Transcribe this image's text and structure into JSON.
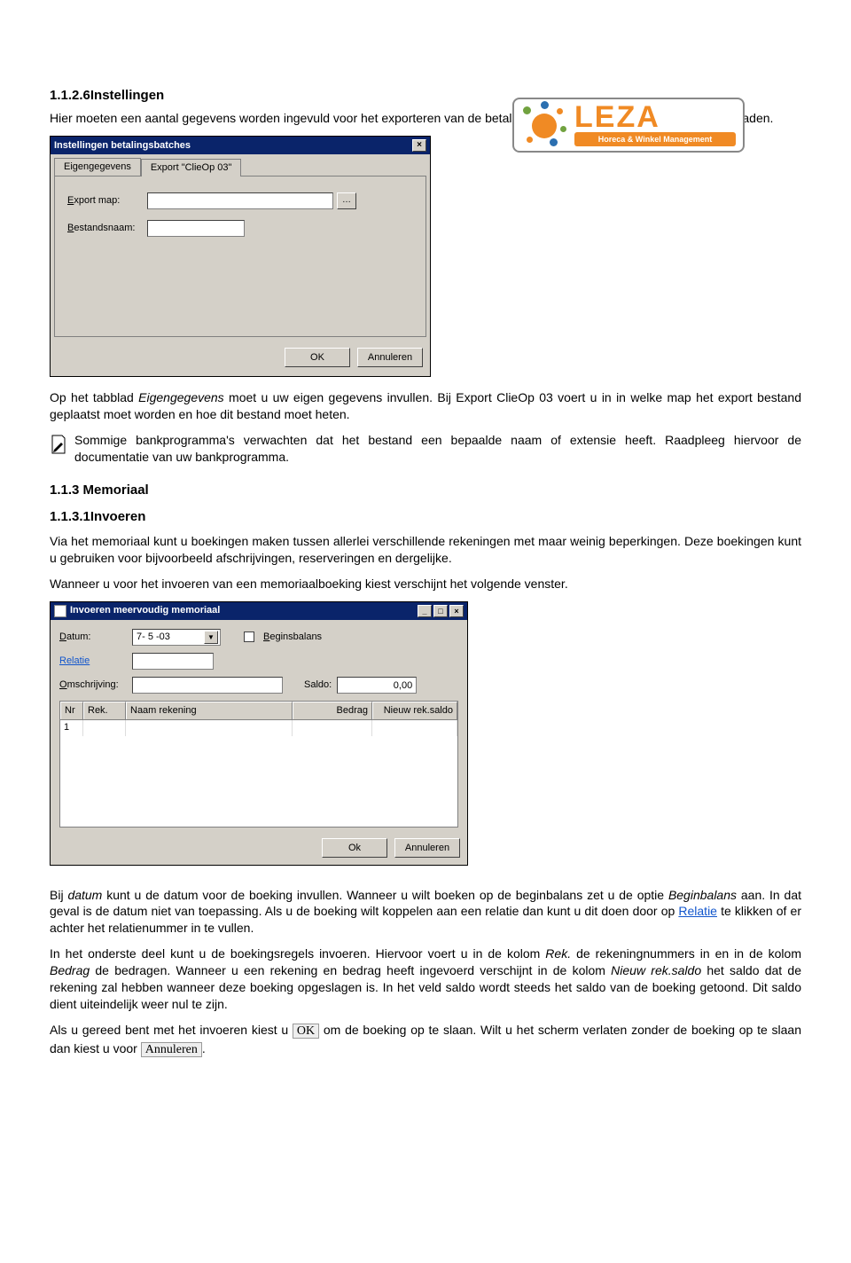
{
  "logo": {
    "brand": "LEZA",
    "tagline": "Horeca & Winkel Management"
  },
  "s1": {
    "num": "1.1.2.6",
    "title": "Instellingen",
    "intro": "Hier moeten een aantal gegevens worden ingevuld voor het exporteren van de betalingsbatches. Het scherm bevat twee tabbladen.",
    "after1a": "Op het tabblad ",
    "after1i": "Eigengegevens",
    "after1b": " moet u uw eigen gegevens invullen. Bij Export ClieOp 03 voert u in in welke map het export bestand geplaatst moet worden en hoe dit bestand moet heten.",
    "note": "Sommige bankprogramma's verwachten dat het bestand een bepaalde naam of extensie heeft. Raadpleeg hiervoor de documentatie van uw bankprogramma."
  },
  "dlg1": {
    "title": "Instellingen betalingsbatches",
    "tab1": "Eigengegevens",
    "tab2": "Export \"ClieOp 03\"",
    "lblExportMap": "Export map:",
    "lblBestandsnaam": "Bestandsnaam:",
    "exportMapValue": "",
    "bestandsnaamValue": "",
    "ok": "OK",
    "cancel": "Annuleren"
  },
  "s2": {
    "h1": "1.1.3 Memoriaal",
    "h2num": "1.1.3.1",
    "h2title": "Invoeren",
    "p1": "Via het memoriaal kunt u boekingen maken tussen allerlei verschillende rekeningen met maar weinig beperkingen. Deze boekingen kunt u gebruiken voor bijvoorbeeld afschrijvingen, reserveringen en dergelijke.",
    "p2": "Wanneer u voor het invoeren van een memoriaalboeking kiest verschijnt het volgende venster."
  },
  "dlg2": {
    "title": "Invoeren meervoudig memoriaal",
    "lblDatum": "Datum:",
    "datumValue": "7- 5 -03",
    "lblBeginsbalans": "Beginsbalans",
    "lblRelatie": "Relatie",
    "relatieValue": "",
    "lblOmschrijving": "Omschrijving:",
    "omschrijvingValue": "",
    "lblSaldo": "Saldo:",
    "saldoValue": "0,00",
    "col": {
      "nr": "Nr",
      "rek": "Rek.",
      "naam": "Naam rekening",
      "bedrag": "Bedrag",
      "saldo": "Nieuw rek.saldo"
    },
    "row1nr": "1",
    "ok": "Ok",
    "cancel": "Annuleren"
  },
  "s3": {
    "p1a": "Bij ",
    "p1i1": "datum",
    "p1b": " kunt u de datum voor de boeking invullen. Wanneer u wilt boeken op de beginbalans zet u de optie ",
    "p1i2": "Beginbalans",
    "p1c": " aan. In dat geval is de datum niet van toepassing. Als u de boeking wilt koppelen aan een relatie dan kunt u dit doen door op ",
    "p1link": "Relatie",
    "p1d": " te klikken of er achter het relatienummer in te vullen.",
    "p2a": "In het onderste deel kunt u de boekingsregels invoeren. Hiervoor voert u in de kolom ",
    "p2i1": "Rek.",
    "p2b": " de rekeningnummers in en in de kolom ",
    "p2i2": "Bedrag",
    "p2c": " de bedragen. Wanneer u een rekening en bedrag heeft ingevoerd verschijnt in de kolom ",
    "p2i3": "Nieuw rek.saldo",
    "p2d": " het saldo dat de rekening zal hebben wanneer deze boeking opgeslagen is. In het veld saldo wordt steeds het saldo van de boeking getoond. Dit saldo dient uiteindelijk weer nul te zijn.",
    "p3a": "Als u gereed bent met het invoeren kiest u ",
    "p3b1": "OK",
    "p3b": " om de boeking op te slaan. Wilt u het scherm verlaten zonder de boeking op te slaan dan kiest u voor ",
    "p3b2": "Annuleren",
    "p3c": "."
  }
}
